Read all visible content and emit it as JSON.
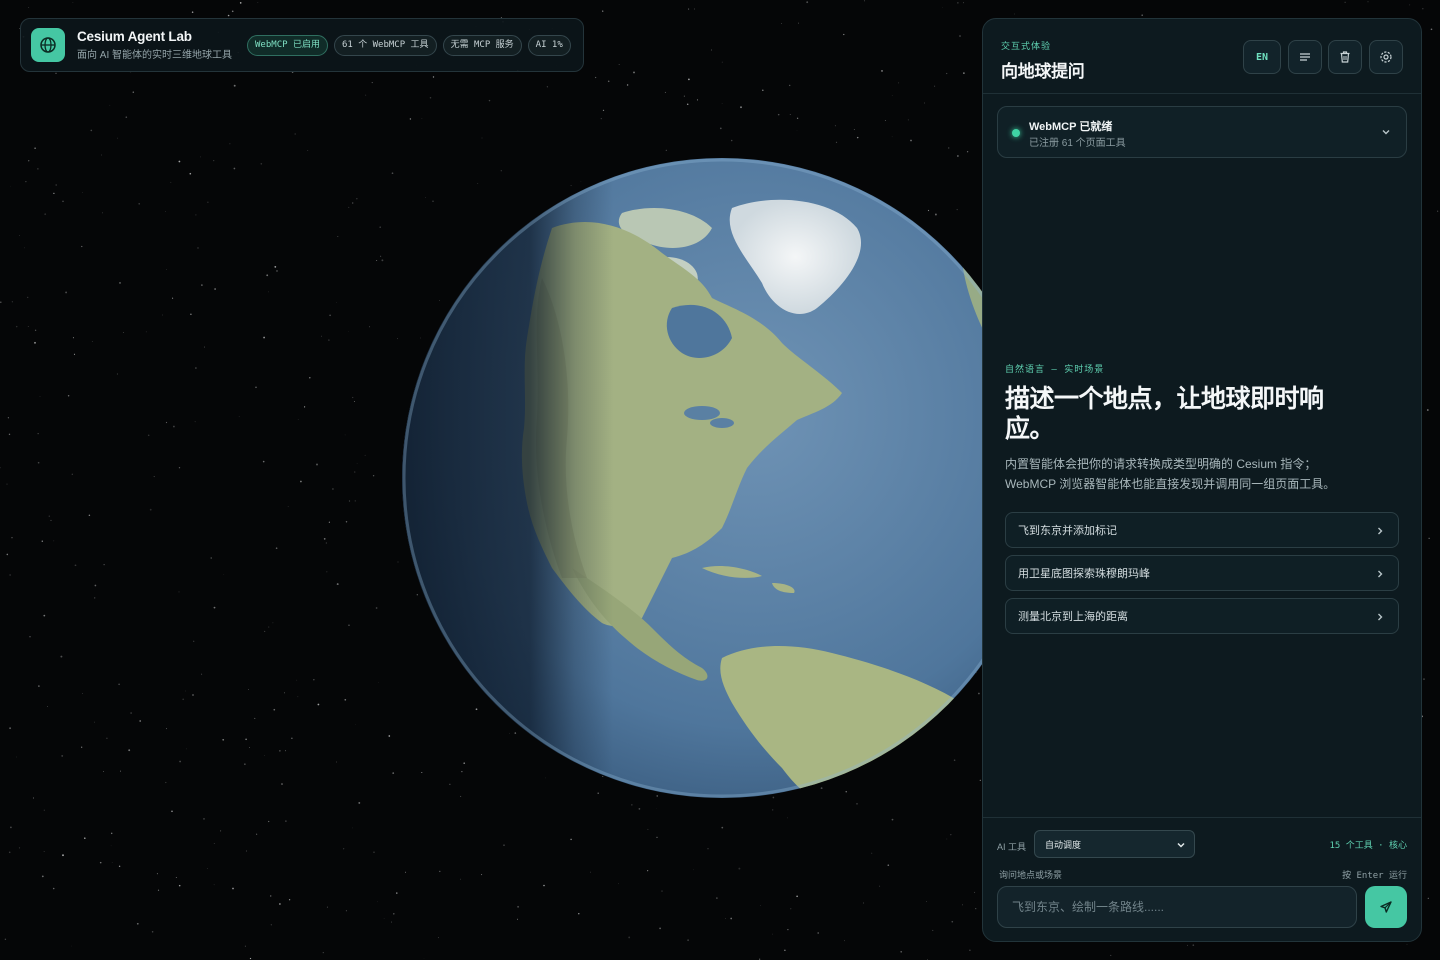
{
  "header": {
    "title": "Cesium Agent Lab",
    "subtitle": "面向 AI 智能体的实时三维地球工具",
    "badges": [
      "WebMCP 已启用",
      "61 个 WebMCP 工具",
      "无需 MCP 服务",
      "AI 1%"
    ]
  },
  "panel": {
    "eyebrow": "交互式体验",
    "title": "向地球提问",
    "lang_button": "EN",
    "status": {
      "title": "WebMCP 已就绪",
      "subtitle": "已注册 61 个页面工具"
    },
    "hero": {
      "eyebrow": "自然语言 — 实时场景",
      "title": "描述一个地点，让地球即时响应。",
      "desc_line1": "内置智能体会把你的请求转换成类型明确的 Cesium 指令；",
      "desc_line2": "WebMCP 浏览器智能体也能直接发现并调用同一组页面工具。"
    },
    "suggestions": [
      "飞到东京并添加标记",
      "用卫星底图探索珠穆朗玛峰",
      "测量北京到上海的距离"
    ],
    "composer": {
      "tool_label": "AI 工具",
      "tool_select_value": "自动调度",
      "tool_count": "15 个工具 · 核心",
      "input_label": "询问地点或场景",
      "enter_hint": "按 Enter 运行",
      "input_placeholder": "飞到东京、绘制一条路线......"
    }
  },
  "icons": {
    "logo": "globe-icon",
    "menu": "menu-lines-icon",
    "trash": "trash-icon",
    "settings": "gear-icon",
    "send": "send-icon"
  },
  "colors": {
    "accent": "#45c7a3",
    "panel_bg": "#0d1a1f",
    "space": "#050607"
  }
}
